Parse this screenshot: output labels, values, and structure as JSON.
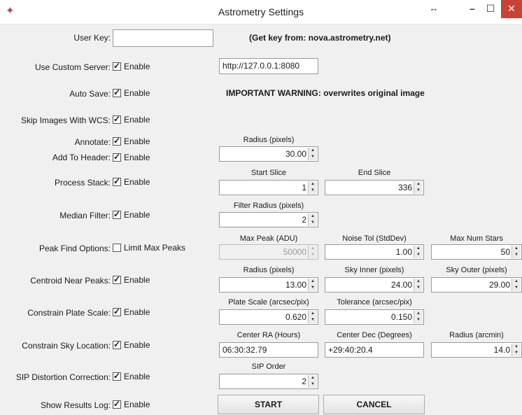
{
  "window": {
    "title": "Astrometry Settings",
    "icons": {
      "app": "astrometry-app-icon",
      "resize": "resize-arrows-icon",
      "minimize": "minimize-icon",
      "maximize": "maximize-icon",
      "close": "close-icon"
    },
    "glyphs": {
      "app": "✦",
      "resize": "↔",
      "minimize": "–",
      "maximize": "☐",
      "close": "✕"
    },
    "close_color": "#c74338"
  },
  "check_text": "Enable",
  "rows": {
    "user_key": {
      "label": "User Key:",
      "value": "",
      "hint": "(Get key from: nova.astrometry.net)"
    },
    "custom_server": {
      "label": "Use Custom Server:",
      "checked": true,
      "url": "http://127.0.0.1:8080"
    },
    "auto_save": {
      "label": "Auto Save:",
      "checked": true,
      "warning": "IMPORTANT WARNING: overwrites original image"
    },
    "skip_wcs": {
      "label": "Skip Images With WCS:",
      "checked": true
    },
    "annotate": {
      "label": "Annotate:",
      "checked": true,
      "radius_header": "Radius (pixels)",
      "radius": "30.00"
    },
    "add_header": {
      "label": "Add To Header:",
      "checked": true
    },
    "process_stack": {
      "label": "Process Stack:",
      "checked": true,
      "start_header": "Start Slice",
      "start": "1",
      "end_header": "End Slice",
      "end": "336"
    },
    "median_filter": {
      "label": "Median Filter:",
      "checked": true,
      "radius_header": "Filter Radius (pixels)",
      "radius": "2"
    },
    "peak_find": {
      "label": "Peak Find Options:",
      "checked": false,
      "check_text": "Limit Max Peaks",
      "max_peak_header": "Max Peak (ADU)",
      "max_peak": "50000",
      "noise_header": "Noise Tol (StdDev)",
      "noise": "1.00",
      "max_stars_header": "Max Num Stars",
      "max_stars": "50"
    },
    "centroid": {
      "label": "Centroid Near Peaks:",
      "checked": true,
      "radius_header": "Radius (pixels)",
      "radius": "13.00",
      "sky_inner_header": "Sky Inner (pixels)",
      "sky_inner": "24.00",
      "sky_outer_header": "Sky Outer (pixels)",
      "sky_outer": "29.00"
    },
    "plate_scale": {
      "label": "Constrain Plate Scale:",
      "checked": true,
      "scale_header": "Plate Scale (arcsec/pix)",
      "scale": "0.620",
      "tol_header": "Tolerance (arcsec/pix)",
      "tol": "0.150"
    },
    "sky_location": {
      "label": "Constrain Sky Location:",
      "checked": true,
      "ra_header": "Center RA (Hours)",
      "ra": "06:30:32.79",
      "dec_header": "Center Dec (Degrees)",
      "dec": "+29:40:20.4",
      "radius_header": "Radius (arcmin)",
      "radius": "14.0"
    },
    "sip": {
      "label": "SIP Distortion Correction:",
      "checked": true,
      "order_header": "SIP Order",
      "order": "2"
    },
    "results_log": {
      "label": "Show Results Log:",
      "checked": true
    }
  },
  "buttons": {
    "start": "START",
    "cancel": "CANCEL"
  }
}
